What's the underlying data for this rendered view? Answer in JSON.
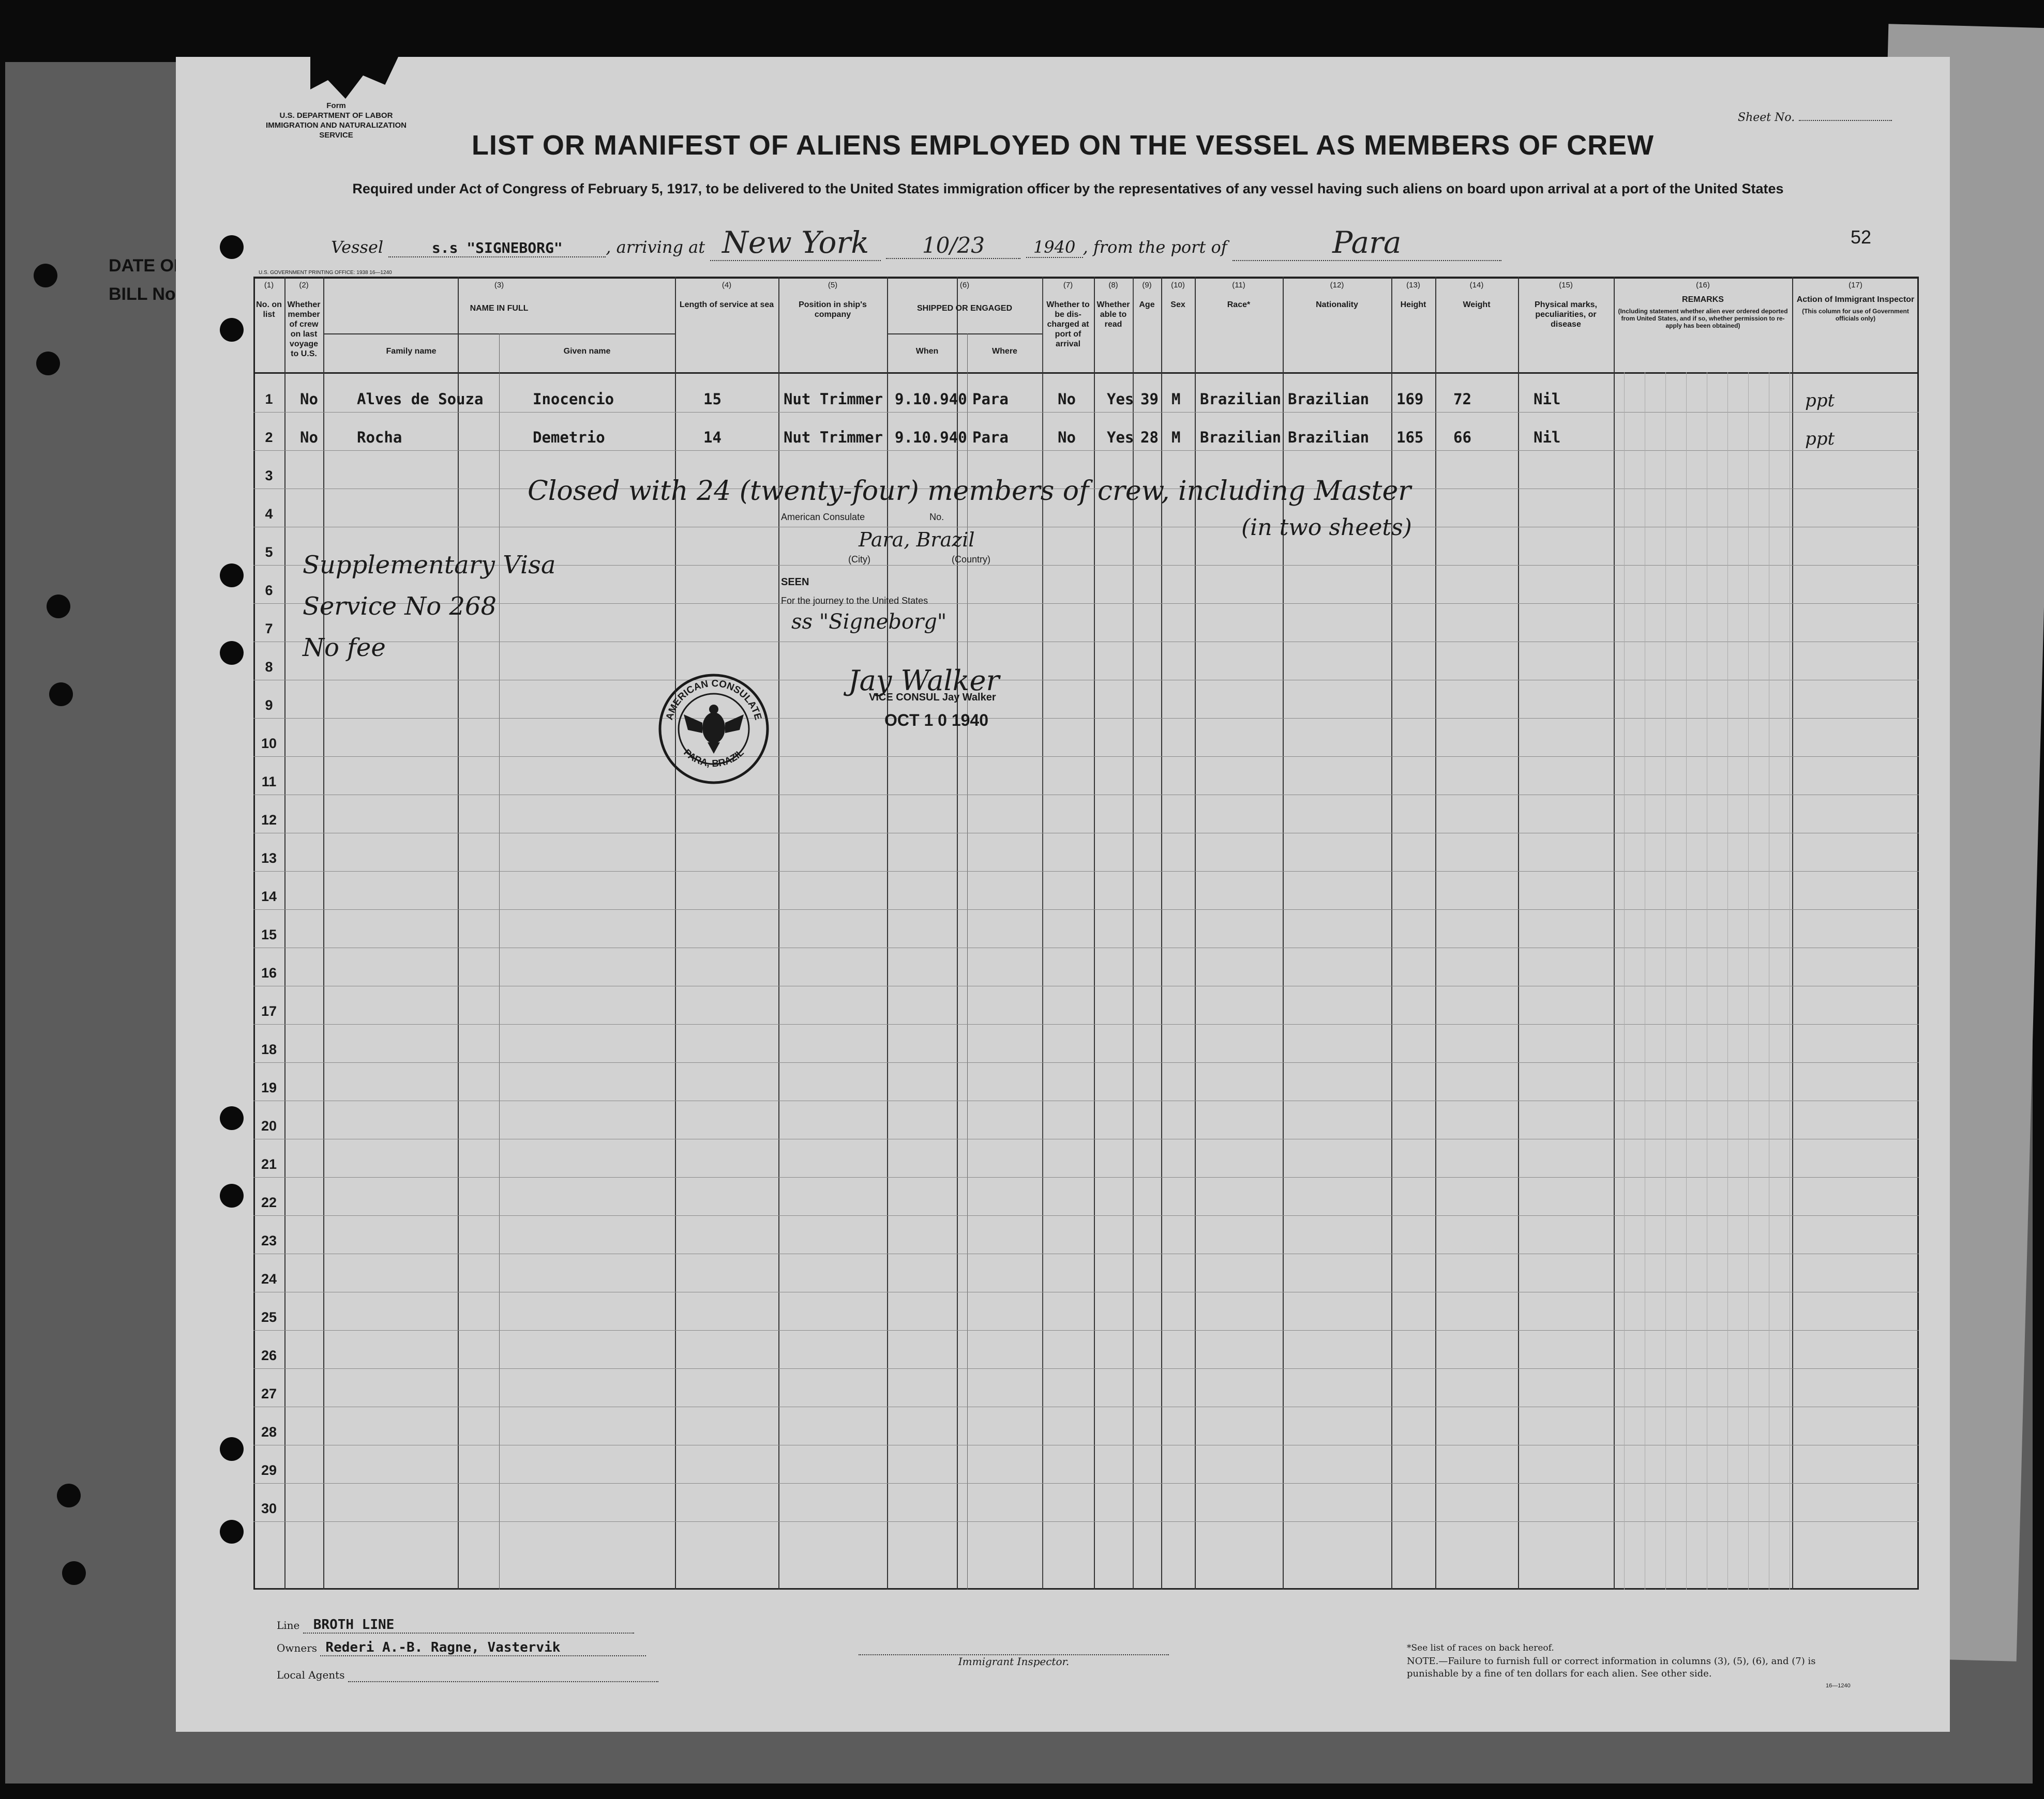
{
  "form_header": [
    "Form",
    "U.S. DEPARTMENT OF LABOR",
    "IMMIGRATION AND NATURALIZATION SERVICE"
  ],
  "sheet_no_label": "Sheet No.",
  "title": "LIST OR MANIFEST OF ALIENS EMPLOYED ON THE VESSEL AS MEMBERS OF CREW",
  "subtitle": "Required under Act of Congress of February 5, 1917, to be delivered to the United States immigration officer by the representatives of any vessel having such aliens on board upon arrival at a port of the United States",
  "vessel_line": {
    "vessel_label": "Vessel",
    "vessel": "s.s \"SIGNEBORG\"",
    "arriving_label": ", arriving at",
    "port": "New York",
    "date": "10/23",
    "year": "1940",
    "from_label": ", from the port of",
    "from_port": "Para"
  },
  "page_number": "52",
  "printing_note": "U.S. GOVERNMENT PRINTING OFFICE: 1938    16—1240",
  "side_stub": [
    "DATE OF",
    "BILL No."
  ],
  "columns": [
    {
      "num": "(1)",
      "label": "No. on list"
    },
    {
      "num": "(2)",
      "label": "Whether member of crew on last voyage to U.S."
    },
    {
      "num": "(3)",
      "label": "NAME IN FULL",
      "sub": [
        "Family name",
        "Given name"
      ]
    },
    {
      "num": "(4)",
      "label": "Length of service at sea"
    },
    {
      "num": "(5)",
      "label": "Position in ship's company"
    },
    {
      "num": "(6)",
      "label": "SHIPPED OR ENGAGED",
      "sub": [
        "When",
        "Where"
      ]
    },
    {
      "num": "(7)",
      "label": "Whether to be dis-charged at port of arrival"
    },
    {
      "num": "(8)",
      "label": "Whether able to read"
    },
    {
      "num": "(9)",
      "label": "Age"
    },
    {
      "num": "(10)",
      "label": "Sex"
    },
    {
      "num": "(11)",
      "label": "Race*"
    },
    {
      "num": "(12)",
      "label": "Nationality"
    },
    {
      "num": "(13)",
      "label": "Height"
    },
    {
      "num": "(14)",
      "label": "Weight"
    },
    {
      "num": "(15)",
      "label": "Physical marks, peculiarities, or disease"
    },
    {
      "num": "(16)",
      "label": "REMARKS",
      "note": "(Including statement whether alien ever ordered deported from United States, and if so, whether permission to re-apply has been obtained)"
    },
    {
      "num": "(17)",
      "label": "Action of Immigrant Inspector",
      "note": "(This column for use of Government officials only)"
    }
  ],
  "rows": [
    {
      "no": "1",
      "last_voyage": "No",
      "family": "Alves de Souza",
      "given": "Inocencio",
      "service": "15",
      "position": "Nut Trimmer",
      "when": "9.10.940",
      "where": "Para",
      "discharged": "No",
      "read": "Yes",
      "age": "39",
      "sex": "M",
      "race": "Brazilian",
      "nationality": "Brazilian",
      "height": "169",
      "weight": "72",
      "marks": "Nil",
      "inspector": "ppt"
    },
    {
      "no": "2",
      "last_voyage": "No",
      "family": "Rocha",
      "given": "Demetrio",
      "service": "14",
      "position": "Nut Trimmer",
      "when": "9.10.940",
      "where": "Para",
      "discharged": "No",
      "read": "Yes",
      "age": "28",
      "sex": "M",
      "race": "Brazilian",
      "nationality": "Brazilian",
      "height": "165",
      "weight": "66",
      "marks": "Nil",
      "inspector": "ppt"
    }
  ],
  "row_numbers": [
    "1",
    "2",
    "3",
    "4",
    "5",
    "6",
    "7",
    "8",
    "9",
    "10",
    "11",
    "12",
    "13",
    "14",
    "15",
    "16",
    "17",
    "18",
    "19",
    "20",
    "21",
    "22",
    "23",
    "24",
    "25",
    "26",
    "27",
    "28",
    "29",
    "30"
  ],
  "handwritten": {
    "closing_note": "Closed with 24 (twenty-four) members of crew, including Master",
    "closing_note2": "(in two sheets)",
    "visa": [
      "Supplementary Visa",
      "Service No 268",
      "No fee"
    ]
  },
  "consular_stamp": {
    "line1": "American Consulate",
    "line1_num": "No.",
    "city_country": "Para, Brazil",
    "city_label": "(City)",
    "country_label": "(Country)",
    "seen": "SEEN",
    "journey": "For the journey to the United States",
    "ship": "ss \"Signeborg\"",
    "signature": "Jay Walker",
    "officer": "VICE CONSUL  Jay Walker",
    "date": "OCT 1 0 1940",
    "seal_top": "AMERICAN CONSULATE",
    "seal_bottom": "PARA, BRAZIL"
  },
  "footer": {
    "line_label": "Line",
    "line_value": "BROTH LINE",
    "owners_label": "Owners",
    "owners_value": "Rederi A.-B. Ragne, Vastervik",
    "agents_label": "Local Agents",
    "inspector_label": "Immigrant Inspector.",
    "races_note": "*See list of races on back hereof.",
    "note": "NOTE.—Failure to furnish full or correct information in columns (3), (5), (6), and (7) is punishable by a fine of ten dollars for each alien. See other side.",
    "form_code": "16—1240"
  }
}
